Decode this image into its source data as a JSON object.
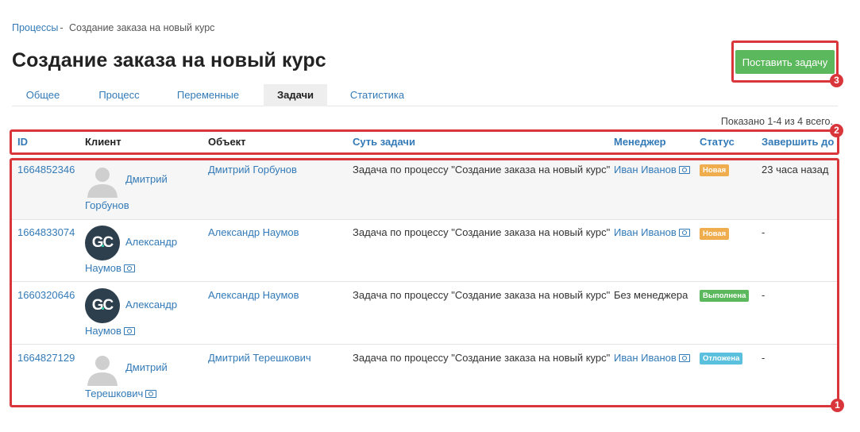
{
  "breadcrumb": {
    "parent": "Процессы",
    "separator": "-",
    "current": "Создание заказа на новый курс"
  },
  "title": "Создание заказа на новый курс",
  "add_task_button": "Поставить задачу",
  "tabs": [
    {
      "label": "Общее"
    },
    {
      "label": "Процесс"
    },
    {
      "label": "Переменные"
    },
    {
      "label": "Задачи",
      "active": true
    },
    {
      "label": "Статистика"
    }
  ],
  "summary": "Показано 1-4 из 4 всего.",
  "columns": {
    "id": "ID",
    "client": "Клиент",
    "object": "Объект",
    "task": "Суть задачи",
    "manager": "Менеджер",
    "status": "Статус",
    "due": "Завершить до"
  },
  "annotations": [
    "1",
    "2",
    "3"
  ],
  "colors": {
    "accent": "#337ab7",
    "highlight_border": "#d9363b",
    "status_new": "#f0ad4e",
    "status_done": "#5cb85c",
    "status_postponed": "#5bc0de"
  },
  "rows": [
    {
      "id": "1664852346",
      "client_first": "Дмитрий",
      "client_last": "Горбунов",
      "avatar": "person-placeholder-icon",
      "object": "Дмитрий Горбунов",
      "task": "Задача по процессу \"Создание заказа на новый курс\"",
      "manager": "Иван Иванов",
      "status": "Новая",
      "due": "23 часа назад"
    },
    {
      "id": "1664833074",
      "client_first": "Александр",
      "client_last": "Наумов",
      "avatar": "gc-logo",
      "avatar_text": "GC",
      "avatar_dot": ".",
      "object": "Александр Наумов",
      "task": "Задача по процессу \"Создание заказа на новый курс\"",
      "manager": "Иван Иванов",
      "status": "Новая",
      "due": "-"
    },
    {
      "id": "1660320646",
      "client_first": "Александр",
      "client_last": "Наумов",
      "avatar": "gc-logo",
      "avatar_text": "GC",
      "avatar_dot": ".",
      "object": "Александр Наумов",
      "task": "Задача по процессу \"Создание заказа на новый курс\"",
      "manager": "Без менеджера",
      "status": "Выполнена",
      "due": "-"
    },
    {
      "id": "1664827129",
      "client_first": "Дмитрий",
      "client_last": "Терешкович",
      "avatar": "person-placeholder-icon",
      "object": "Дмитрий Терешкович",
      "task": "Задача по процессу \"Создание заказа на новый курс\"",
      "manager": "Иван Иванов",
      "status": "Отложена",
      "due": "-"
    }
  ]
}
